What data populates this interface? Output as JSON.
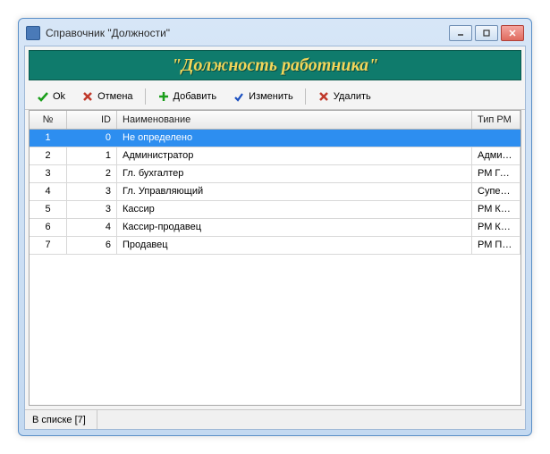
{
  "window": {
    "title": "Справочник \"Должности\""
  },
  "banner": {
    "text": "\"Должность работника\""
  },
  "toolbar": {
    "ok": "Ok",
    "cancel": "Отмена",
    "add": "Добавить",
    "edit": "Изменить",
    "delete": "Удалить"
  },
  "columns": {
    "num": "№",
    "id": "ID",
    "name": "Наименование",
    "rm": "Тип РМ"
  },
  "rows": [
    {
      "num": "1",
      "id": "0",
      "name": "Не определено",
      "rm": ""
    },
    {
      "num": "2",
      "id": "1",
      "name": "Администратор",
      "rm": "Админис"
    },
    {
      "num": "3",
      "id": "2",
      "name": "Гл. бухгалтер",
      "rm": "РМ Глав."
    },
    {
      "num": "4",
      "id": "3",
      "name": "Гл. Управляющий",
      "rm": "Суперви."
    },
    {
      "num": "5",
      "id": "3",
      "name": "Кассир",
      "rm": "РМ Касс."
    },
    {
      "num": "6",
      "id": "4",
      "name": "Кассир-продавец",
      "rm": "РМ Касс."
    },
    {
      "num": "7",
      "id": "6",
      "name": "Продавец",
      "rm": "РМ Прод"
    }
  ],
  "status": {
    "count_label": "В списке [7]"
  },
  "icons": {
    "ok_color": "#1a9e1a",
    "cancel_color": "#c0392b",
    "add_color": "#1a9e1a",
    "edit_color": "#1a4fc0",
    "delete_color": "#c0392b"
  }
}
